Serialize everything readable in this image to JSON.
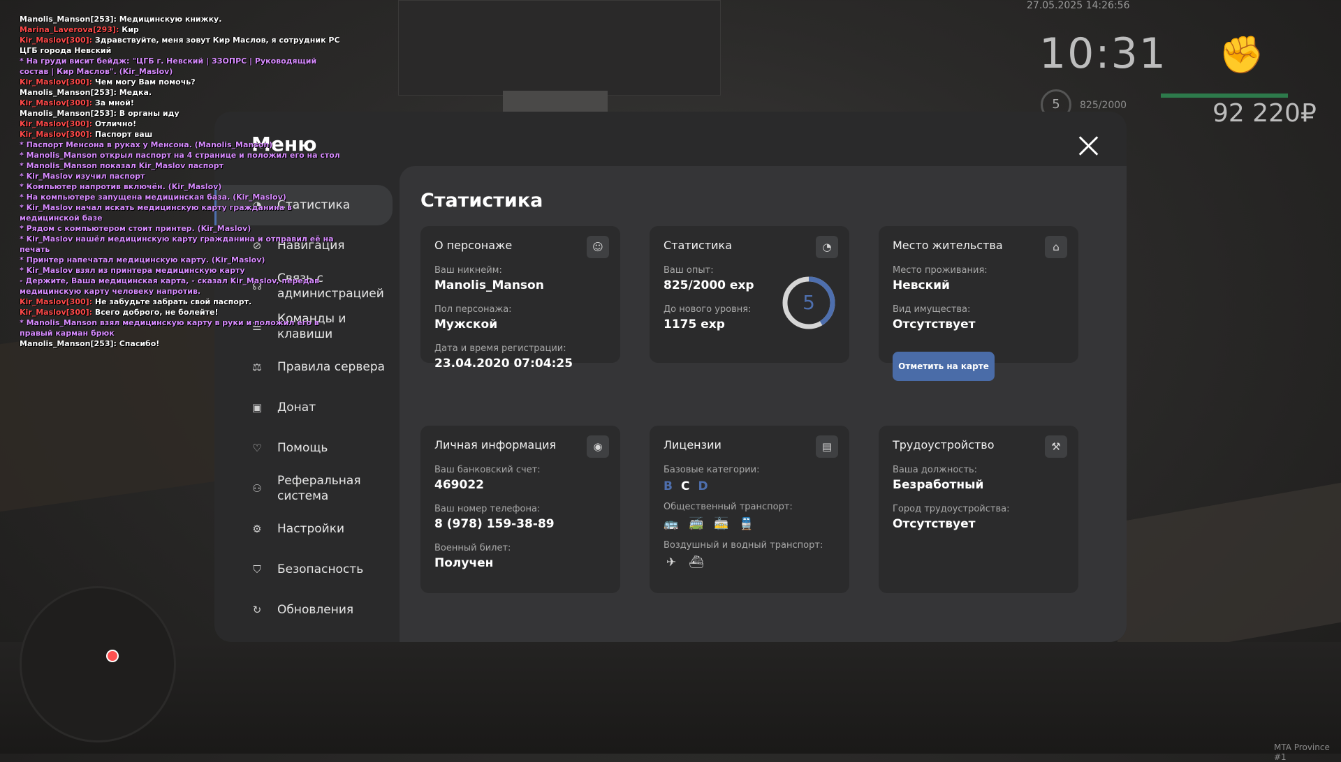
{
  "chat": [
    {
      "cls": "w",
      "text": "Manolis_Manson[253]: Медицинскую книжку."
    },
    {
      "cls": "r",
      "name": "Marina_Laverova[293]:",
      "text": " Кир"
    },
    {
      "cls": "r",
      "name": "Kir_Maslov[300]:",
      "text": " Здравствуйте, меня зовут Кир Маслов, я сотрудник РС ЦГБ города Невский"
    },
    {
      "cls": "p",
      "text": " * На груди висит бейдж: \"ЦГБ г. Невский | ЗЗОПРС | Руководящий состав | Кир Маслов\". (Kir_Maslov)"
    },
    {
      "cls": "r",
      "name": "Kir_Maslov[300]:",
      "text": " Чем могу Вам помочь?"
    },
    {
      "cls": "w",
      "text": "Manolis_Manson[253]: Медка."
    },
    {
      "cls": "r",
      "name": "Kir_Maslov[300]:",
      "text": " За мной!"
    },
    {
      "cls": "w",
      "text": "Manolis_Manson[253]: В органы иду"
    },
    {
      "cls": "r",
      "name": "Kir_Maslov[300]:",
      "text": " Отлично!"
    },
    {
      "cls": "r",
      "name": "Kir_Maslov[300]:",
      "text": " Паспорт ваш"
    },
    {
      "cls": "p",
      "text": " * Паспорт Менсона в руках у Менсона. (Manolis_Manson)"
    },
    {
      "cls": "p",
      "text": " * Manolis_Manson открыл паспорт на 4 странице и положил его на стол"
    },
    {
      "cls": "p",
      "text": " * Manolis_Manson показал Kir_Maslov паспорт"
    },
    {
      "cls": "p",
      "text": " * Kir_Maslov изучил паспорт"
    },
    {
      "cls": "p",
      "text": " * Компьютер напротив включён. (Kir_Maslov)"
    },
    {
      "cls": "p",
      "text": " * На компьютере запущена медицинская база. (Kir_Maslov)"
    },
    {
      "cls": "p",
      "text": " * Kir_Maslov начал искать медицинскую карту гражданина в медицинской базе"
    },
    {
      "cls": "p",
      "text": " * Рядом с компьютером стоит принтер. (Kir_Maslov)"
    },
    {
      "cls": "p",
      "text": " * Kir_Maslov нашёл медицинскую карту гражданина и отправил её на печать"
    },
    {
      "cls": "p",
      "text": " * Принтер напечатал медицинскую карту. (Kir_Maslov)"
    },
    {
      "cls": "p",
      "text": " * Kir_Maslov взял из принтера медицинскую карту"
    },
    {
      "cls": "p",
      "text": " - Держите, Ваша медицинская карта, - сказал Kir_Maslov, передав медицинскую карту человеку напротив."
    },
    {
      "cls": "r",
      "name": "Kir_Maslov[300]:",
      "text": " Не забудьте забрать свой паспорт."
    },
    {
      "cls": "r",
      "name": "Kir_Maslov[300]:",
      "text": " Всего доброго, не болейте!"
    },
    {
      "cls": "p",
      "text": " * Manolis_Manson взял медицинскую карту в руки и положил его в правый карман брюк"
    },
    {
      "cls": "w",
      "text": "Manolis_Manson[253]: Спасибо!"
    }
  ],
  "hud": {
    "date": "27.05.2025 14:26:56",
    "time": "10:31",
    "level": "5",
    "exp": "825/2000",
    "money": "92 220₽",
    "server": "MTA Province #1"
  },
  "menu": {
    "title": "Меню",
    "items": [
      {
        "label": "Статистика",
        "icon": "stats-icon",
        "glyph": "◔",
        "active": true
      },
      {
        "label": "Навигация",
        "icon": "compass-icon",
        "glyph": "⊘",
        "active": false
      },
      {
        "label": "Связь с администрацией",
        "icon": "headset-icon",
        "glyph": "☊",
        "active": false
      },
      {
        "label": "Команды и клавиши",
        "icon": "keyboard-icon",
        "glyph": "☰",
        "active": false
      },
      {
        "label": "Правила сервера",
        "icon": "scales-icon",
        "glyph": "⚖",
        "active": false
      },
      {
        "label": "Донат",
        "icon": "wallet-icon",
        "glyph": "▣",
        "active": false
      },
      {
        "label": "Помощь",
        "icon": "help-icon",
        "glyph": "♡",
        "active": false
      },
      {
        "label": "Реферальная система",
        "icon": "referral-icon",
        "glyph": "⚇",
        "active": false
      },
      {
        "label": "Настройки",
        "icon": "gear-icon",
        "glyph": "⚙",
        "active": false
      },
      {
        "label": "Безопасность",
        "icon": "shield-icon",
        "glyph": "⛉",
        "active": false
      },
      {
        "label": "Обновления",
        "icon": "refresh-icon",
        "glyph": "↻",
        "active": false
      }
    ]
  },
  "content": {
    "title": "Статистика",
    "character": {
      "title": "О персонаже",
      "nick_label": "Ваш никнейм:",
      "nick": "Manolis_Manson",
      "sex_label": "Пол персонажа:",
      "sex": "Мужской",
      "reg_label": "Дата и время регистрации:",
      "reg": "23.04.2020 07:04:25"
    },
    "stats": {
      "title": "Статистика",
      "exp_label": "Ваш опыт:",
      "exp": "825/2000 exp",
      "next_label": "До нового уровня:",
      "next": "1175 exp",
      "level": "5",
      "progress": 0.4125
    },
    "residence": {
      "title": "Место жительства",
      "place_label": "Место проживания:",
      "place": "Невский",
      "property_label": "Вид имущества:",
      "property": "Отсутствует",
      "button": "Отметить на карте"
    },
    "personal": {
      "title": "Личная информация",
      "bank_label": "Ваш банковский счет:",
      "bank": "469022",
      "phone_label": "Ваш номер телефона:",
      "phone": "8 (978) 159-38-89",
      "military_label": "Военный билет:",
      "military": "Получен"
    },
    "licenses": {
      "title": "Лицензии",
      "base_label": "Базовые категории:",
      "categories": [
        {
          "letter": "B",
          "color": "#4e6fae"
        },
        {
          "letter": "C",
          "color": "#ffffff"
        },
        {
          "letter": "D",
          "color": "#4e6fae"
        }
      ],
      "public_label": "Общественный транспорт:",
      "public_icons": [
        "bus-icon",
        "trolleybus-icon",
        "tram-icon",
        "train-icon"
      ],
      "air_label": "Воздушный и водный транспорт:",
      "air_icons": [
        "plane-icon",
        "ship-icon"
      ]
    },
    "job": {
      "title": "Трудоустройство",
      "position_label": "Ваша должность:",
      "position": "Безработный",
      "city_label": "Город трудоустройства:",
      "city": "Отсутствует"
    }
  }
}
